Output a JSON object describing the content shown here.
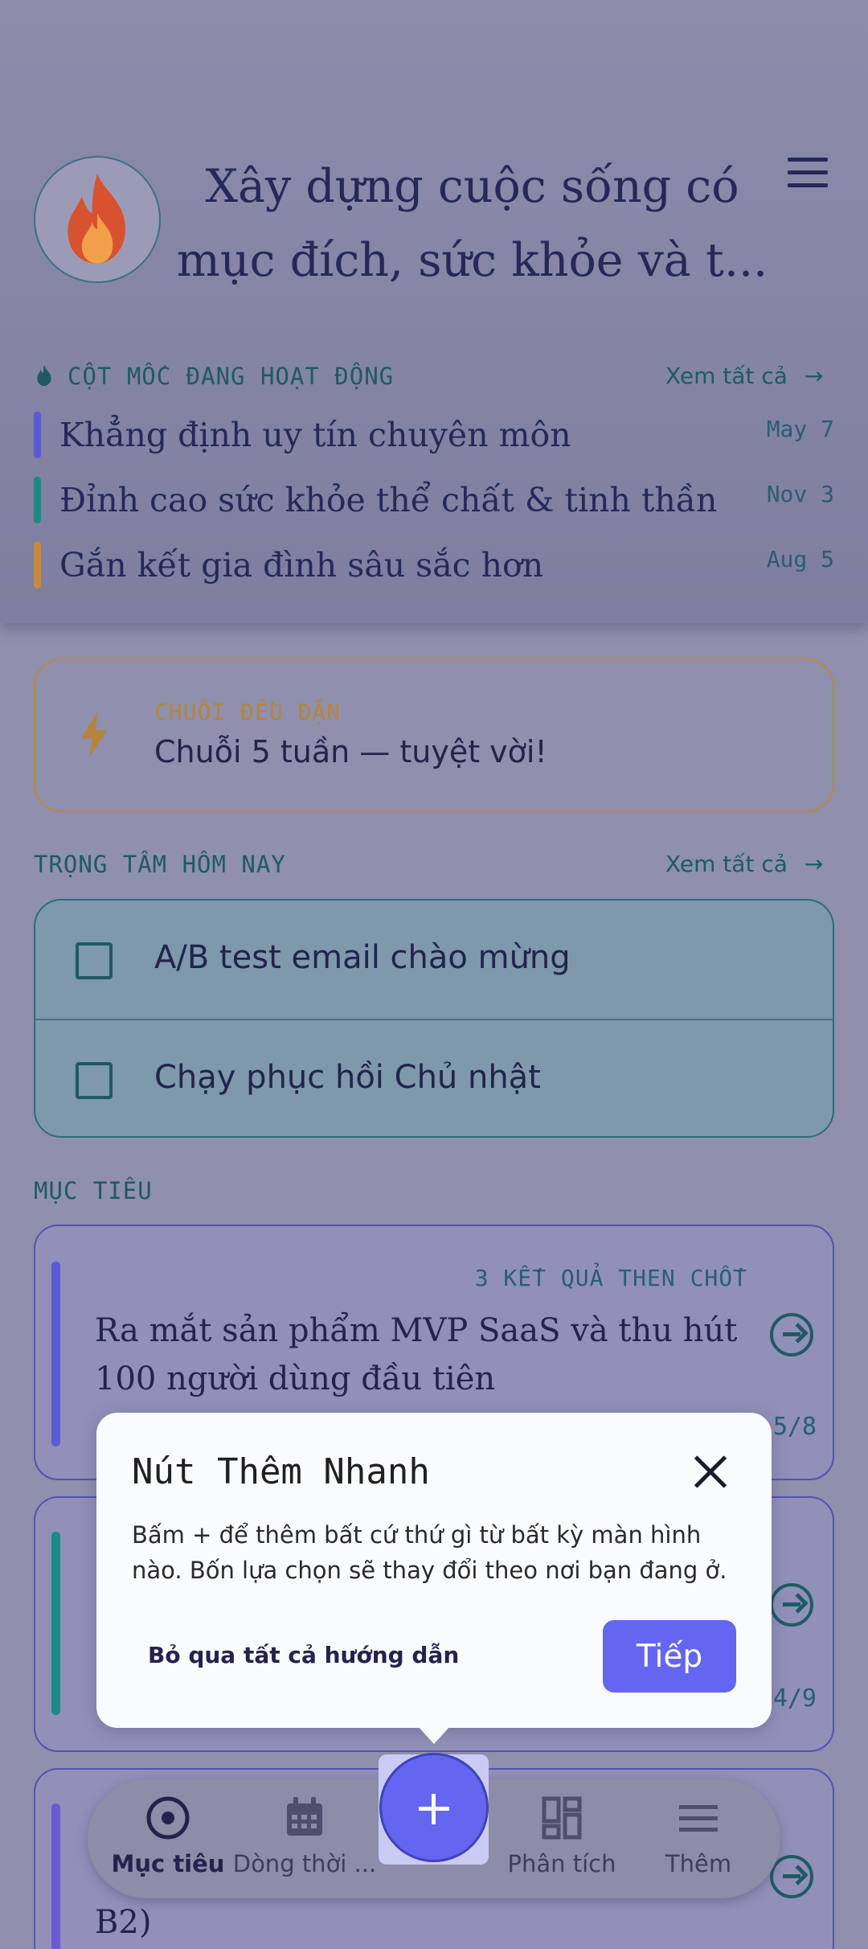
{
  "header": {
    "title_line1": "Xây dựng cuộc sống có",
    "title_line2": "mục đích, sức khỏe và t...",
    "avatar_icon": "flame-icon",
    "menu_icon": "hamburger-menu-icon"
  },
  "milestones": {
    "label": "CỘT MỐC ĐANG HOẠT ĐỘNG",
    "see_all": "Xem tất cả",
    "items": [
      {
        "title": "Khẳng định uy tín chuyên môn",
        "date": "May 7",
        "color": "#5a5cd6"
      },
      {
        "title": "Đỉnh cao sức khỏe thể chất & tinh thần",
        "date": "Nov 3",
        "color": "#1e8a86"
      },
      {
        "title": "Gắn kết gia đình sâu sắc hơn",
        "date": "Aug 5",
        "color": "#c88b3a"
      }
    ]
  },
  "streak": {
    "label": "CHUỖI ĐỀU ĐẶN",
    "text": "Chuỗi 5 tuần — tuyệt vời!",
    "icon": "lightning-bolt-icon"
  },
  "focus": {
    "label": "TRỌNG TÂM HÔM NAY",
    "see_all": "Xem tất cả",
    "tasks": [
      {
        "text": "A/B test email chào mừng",
        "checked": false
      },
      {
        "text": "Chạy phục hồi Chủ nhật",
        "checked": false
      }
    ]
  },
  "goals": {
    "label": "MỤC TIÊU",
    "items": [
      {
        "key_results": "3 KẾT QUẢ THEN CHỐT",
        "title": "Ra mắt sản phẩm MVP SaaS và thu hút 100 người dùng đầu tiên",
        "count": "5/8",
        "color": "#5a5cd6"
      },
      {
        "count": "4/9",
        "color": "#1e8a86"
      },
      {
        "title_fragment": "B2)",
        "color": "#6b5ad6"
      }
    ]
  },
  "tooltip": {
    "title": "Nút Thêm Nhanh",
    "body": "Bấm + để thêm bất cứ thứ gì từ bất kỳ màn hình nào. Bốn lựa chọn sẽ thay đổi theo nơi bạn đang ở.",
    "skip": "Bỏ qua tất cả hướng dẫn",
    "next": "Tiếp"
  },
  "nav": {
    "items": [
      {
        "label": "Mục tiêu",
        "icon": "target-icon",
        "active": true
      },
      {
        "label": "Dòng thời ...",
        "icon": "calendar-icon",
        "active": false
      },
      {
        "label": "Phân tích",
        "icon": "dashboard-icon",
        "active": false
      },
      {
        "label": "Thêm",
        "icon": "menu-icon",
        "active": false
      }
    ],
    "fab_icon": "plus-icon"
  }
}
